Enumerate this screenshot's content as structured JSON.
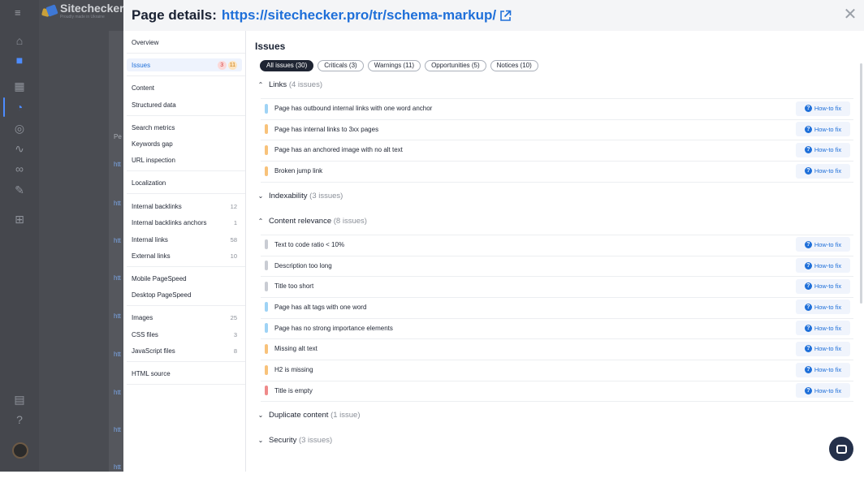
{
  "background_app": {
    "logo_title": "Sitechecker",
    "logo_tagline": "Proudly made in Ukraine",
    "column_stub": "Pe",
    "link_stubs": [
      "htt",
      "htt",
      "htt",
      "htt",
      "htt",
      "htt",
      "htt",
      "htt",
      "htt"
    ]
  },
  "modal": {
    "title_prefix": "Page details:",
    "title_url": "https://sitechecker.pro/tr/schema-markup/"
  },
  "sidebar": {
    "items": [
      {
        "label": "Overview",
        "count": ""
      },
      {
        "label": "Issues",
        "count": "",
        "badge_red": "3",
        "badge_orange": "11"
      },
      {
        "label": "Content",
        "count": ""
      },
      {
        "label": "Structured data",
        "count": ""
      },
      {
        "label": "Search metrics",
        "count": ""
      },
      {
        "label": "Keywords gap",
        "count": ""
      },
      {
        "label": "URL inspection",
        "count": ""
      },
      {
        "label": "Localization",
        "count": ""
      },
      {
        "label": "Internal backlinks",
        "count": "12"
      },
      {
        "label": "Internal backlinks anchors",
        "count": "1"
      },
      {
        "label": "Internal links",
        "count": "58"
      },
      {
        "label": "External links",
        "count": "10"
      },
      {
        "label": "Mobile PageSpeed",
        "count": ""
      },
      {
        "label": "Desktop PageSpeed",
        "count": ""
      },
      {
        "label": "Images",
        "count": "25"
      },
      {
        "label": "CSS files",
        "count": "3"
      },
      {
        "label": "JavaScript files",
        "count": "8"
      },
      {
        "label": "HTML source",
        "count": ""
      }
    ]
  },
  "main": {
    "title": "Issues",
    "filters": [
      {
        "label": "All issues (30)",
        "active": true
      },
      {
        "label": "Criticals (3)",
        "active": false
      },
      {
        "label": "Warnings (11)",
        "active": false
      },
      {
        "label": "Opportunities (5)",
        "active": false
      },
      {
        "label": "Notices (10)",
        "active": false
      }
    ],
    "how_to_fix_label": "How-to fix",
    "groups": [
      {
        "name": "Links",
        "count_text": "(4 issues)",
        "expanded": true,
        "issues": [
          {
            "text": "Page has outbound internal links with one word anchor",
            "severity": "notice"
          },
          {
            "text": "Page has internal links to 3xx pages",
            "severity": "warning"
          },
          {
            "text": "Page has an anchored image with no alt text",
            "severity": "warning"
          },
          {
            "text": "Broken jump link",
            "severity": "warning"
          }
        ]
      },
      {
        "name": "Indexability",
        "count_text": "(3 issues)",
        "expanded": false,
        "issues": []
      },
      {
        "name": "Content relevance",
        "count_text": "(8 issues)",
        "expanded": true,
        "issues": [
          {
            "text": "Text to code ratio < 10%",
            "severity": "info"
          },
          {
            "text": "Description too long",
            "severity": "info"
          },
          {
            "text": "Title too short",
            "severity": "info"
          },
          {
            "text": "Page has alt tags with one word",
            "severity": "notice"
          },
          {
            "text": "Page has no strong importance elements",
            "severity": "notice"
          },
          {
            "text": "Missing alt text",
            "severity": "warning"
          },
          {
            "text": "H2 is missing",
            "severity": "warning"
          },
          {
            "text": "Title is empty",
            "severity": "critical"
          }
        ]
      },
      {
        "name": "Duplicate content",
        "count_text": "(1 issue)",
        "expanded": false,
        "issues": []
      },
      {
        "name": "Security",
        "count_text": "(3 issues)",
        "expanded": false,
        "issues": []
      }
    ]
  },
  "colors": {
    "critical": "#ef8a8a",
    "warning": "#f8c27a",
    "notice": "#9fd3f5",
    "info": "#c9ccd3",
    "accent": "#1e6fd9"
  },
  "icons": {
    "external_link": "external-link-icon",
    "close": "close-icon",
    "help": "question-circle-icon",
    "chat": "chat-icon"
  }
}
